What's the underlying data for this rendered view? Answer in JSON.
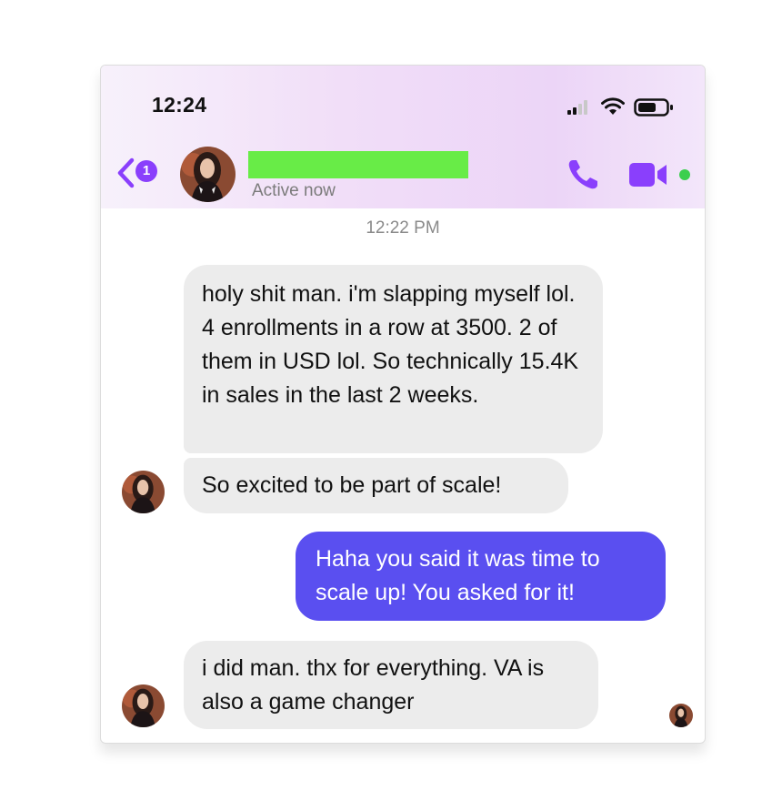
{
  "status_bar": {
    "time": "12:24",
    "icons": [
      "signal-icon",
      "wifi-icon",
      "battery-icon"
    ]
  },
  "header": {
    "back_count": "1",
    "contact_name_redacted": true,
    "contact_status": "Active now",
    "icons": [
      "back-chevron-icon",
      "phone-icon",
      "video-camera-icon"
    ],
    "accent_color": "#8a3ffc"
  },
  "conversation": {
    "timestamp": "12:22 PM",
    "messages": [
      {
        "direction": "incoming",
        "text": "holy shit man. i'm slapping myself lol. 4 enrollments in a row at 3500. 2 of them in USD lol. So technically 15.4K in sales in the last 2 weeks."
      },
      {
        "direction": "incoming",
        "text": "So excited to be part of scale!"
      },
      {
        "direction": "outgoing",
        "text": "Haha you said it was time to scale up! You asked for it!"
      },
      {
        "direction": "incoming",
        "text": "i did man. thx for everything. VA is also a game changer"
      }
    ],
    "outgoing_color": "#5a4ff0",
    "incoming_color": "#ececec"
  }
}
